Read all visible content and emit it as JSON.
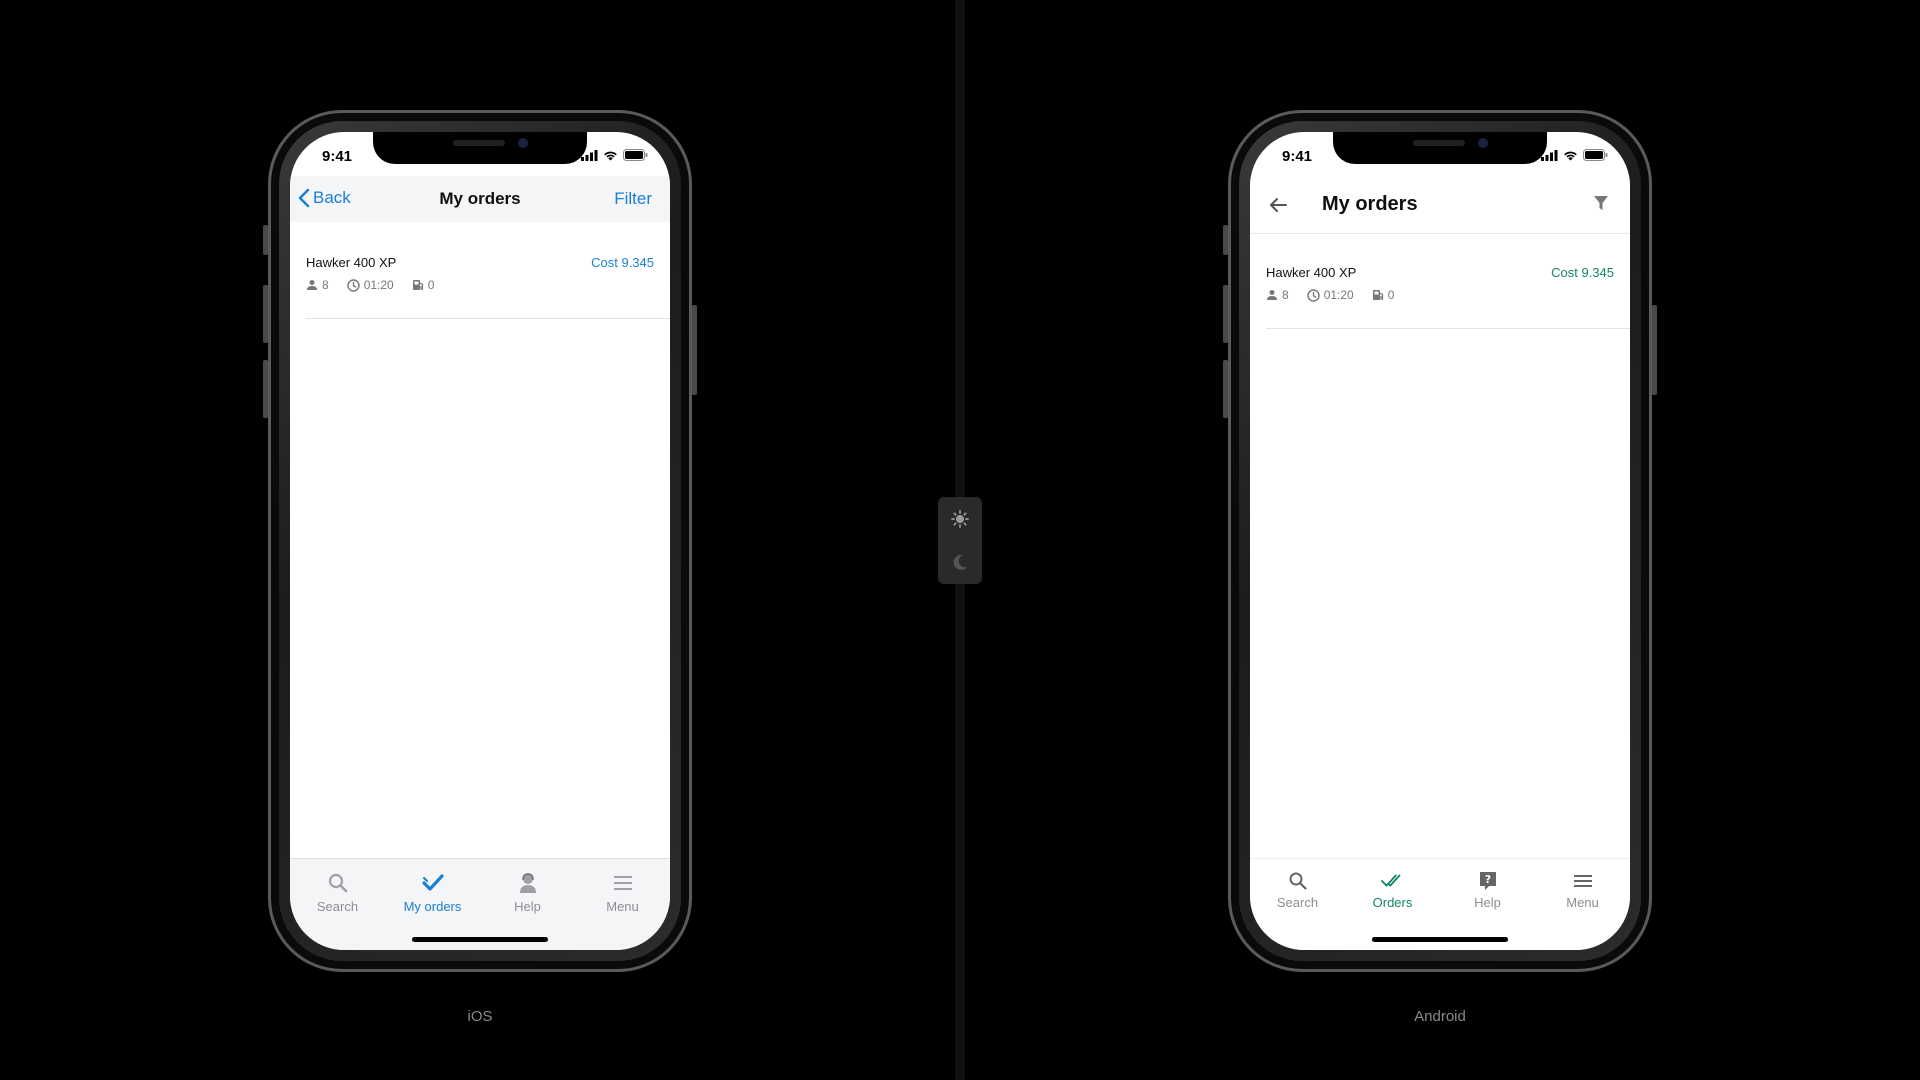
{
  "status": {
    "time": "9:41"
  },
  "platforms": {
    "ios_label": "iOS",
    "android_label": "Android"
  },
  "ios": {
    "nav": {
      "back_label": "Back",
      "title": "My orders",
      "filter_label": "Filter"
    },
    "order": {
      "name": "Hawker 400 XP",
      "cost": "Cost 9.345",
      "passengers": "8",
      "duration": "01:20",
      "fuel": "0"
    },
    "tabs": [
      {
        "label": "Search",
        "icon": "search-icon"
      },
      {
        "label": "My orders",
        "icon": "check-icon",
        "active": true
      },
      {
        "label": "Help",
        "icon": "person-icon"
      },
      {
        "label": "Menu",
        "icon": "menu-icon"
      }
    ]
  },
  "android": {
    "nav": {
      "title": "My orders"
    },
    "order": {
      "name": "Hawker 400 XP",
      "cost": "Cost 9.345",
      "passengers": "8",
      "duration": "01:20",
      "fuel": "0"
    },
    "tabs": [
      {
        "label": "Search",
        "icon": "search-icon"
      },
      {
        "label": "Orders",
        "icon": "double-check-icon",
        "active": true
      },
      {
        "label": "Help",
        "icon": "help-icon"
      },
      {
        "label": "Menu",
        "icon": "menu-icon"
      }
    ]
  },
  "colors": {
    "ios_accent": "#1a7fd8",
    "android_accent": "#12866b",
    "inactive": "#8e8e93",
    "background": "#000000"
  }
}
